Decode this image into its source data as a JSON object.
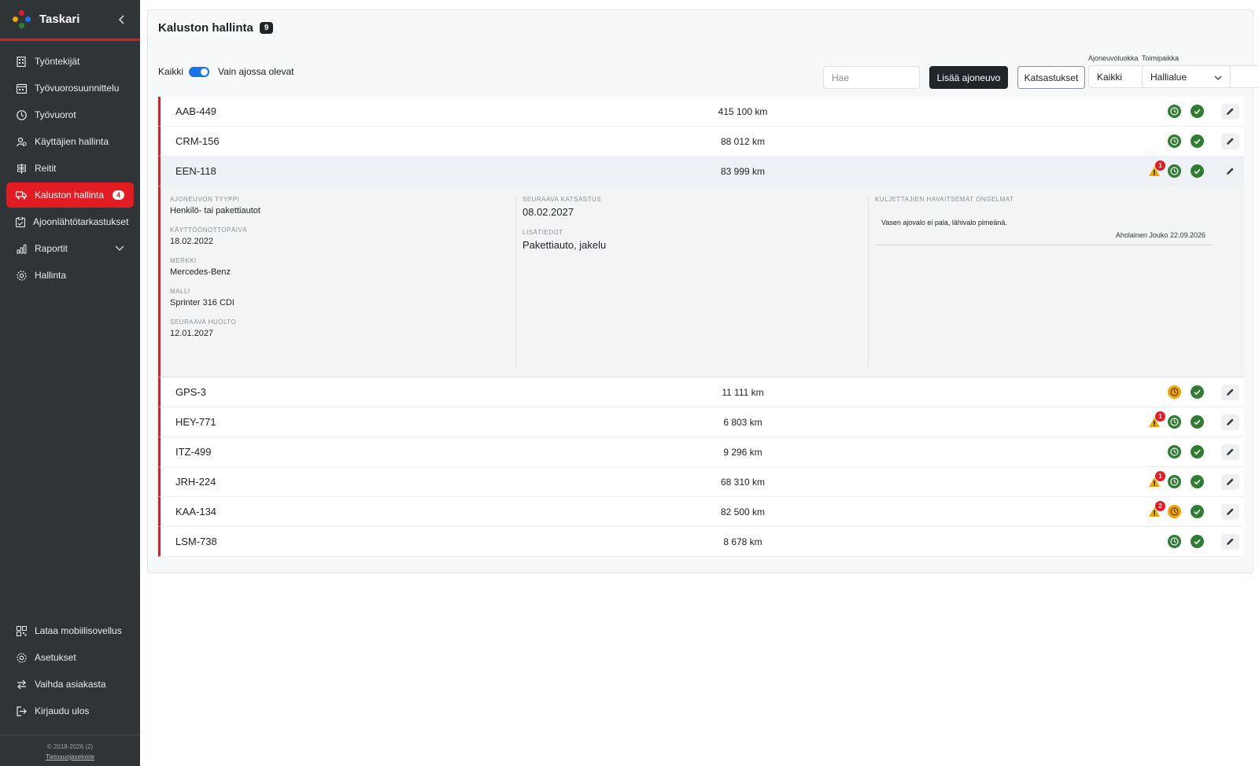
{
  "app": {
    "name": "Taskari"
  },
  "sidebar": {
    "items": [
      {
        "label": "Työntekijät",
        "icon": "building-icon"
      },
      {
        "label": "Työvuorosuunnittelu",
        "icon": "calendar-icon"
      },
      {
        "label": "Työvuorot",
        "icon": "clock-icon"
      },
      {
        "label": "Käyttäjien hallinta",
        "icon": "users-icon"
      },
      {
        "label": "Reitit",
        "icon": "signpost-icon"
      },
      {
        "label": "Kaluston hallinta",
        "icon": "truck-icon",
        "badge": "4",
        "active": true
      },
      {
        "label": "Ajoonlähtötarkastukset",
        "icon": "clipboard-icon"
      },
      {
        "label": "Raportit",
        "icon": "chart-icon"
      },
      {
        "label": "Hallinta",
        "icon": "gear-icon"
      }
    ],
    "bottom_items": [
      {
        "label": "Lataa mobiilisovellus",
        "icon": "qr-icon"
      },
      {
        "label": "Asetukset",
        "icon": "gear-icon"
      },
      {
        "label": "Vaihda asiakasta",
        "icon": "swap-icon"
      },
      {
        "label": "Kirjaudu ulos",
        "icon": "logout-icon"
      }
    ],
    "footer": {
      "copyright": "© 2018-2026 (2)",
      "privacy": "Tietosuojaseloste"
    }
  },
  "page": {
    "title": "Kaluston hallinta",
    "count": "9",
    "toggle_left": "Kaikki",
    "toggle_right": "Vain ajossa olevat",
    "search_placeholder": "Hae",
    "add_button": "Lisää ajoneuvo",
    "inspections_button": "Katsastukset",
    "vehicle_class": {
      "label": "Ajoneuvoluokka",
      "value": "Kaikki"
    },
    "location": {
      "label": "Toimipaikka",
      "value": "Hallialue"
    }
  },
  "vehicles": [
    {
      "plate": "AAB-449",
      "km": "415 100 km",
      "warnings": "",
      "clock": "green"
    },
    {
      "plate": "CRM-156",
      "km": "88 012 km",
      "warnings": "",
      "clock": "green"
    },
    {
      "plate": "EEN-118",
      "km": "83 999 km",
      "warnings": "1",
      "clock": "green"
    },
    {
      "plate": "GPS-3",
      "km": "11 111 km",
      "warnings": "",
      "clock": "orange"
    },
    {
      "plate": "HEY-771",
      "km": "6 803 km",
      "warnings": "1",
      "clock": "green"
    },
    {
      "plate": "ITZ-499",
      "km": "9 296 km",
      "warnings": "",
      "clock": "green"
    },
    {
      "plate": "JRH-224",
      "km": "68 310 km",
      "warnings": "1",
      "clock": "green"
    },
    {
      "plate": "KAA-134",
      "km": "82 500 km",
      "warnings": "2",
      "clock": "orange"
    },
    {
      "plate": "LSM-738",
      "km": "8 678 km",
      "warnings": "",
      "clock": "green"
    }
  ],
  "details": {
    "type_label": "AJONEUVON TYYPPI",
    "type_value": "Henkilö- tai pakettiautot",
    "start_label": "KÄYTTÖÖNOTTOPÄIVÄ",
    "start_value": "18.02.2022",
    "brand_label": "MERKKI",
    "brand_value": "Mercedes-Benz",
    "model_label": "MALLI",
    "model_value": "Sprinter 316 CDI",
    "service_label": "SEURAAVA HUOLTO",
    "service_value": "12.01.2027",
    "inspection_label": "SEURAAVA KATSASTUS",
    "inspection_value": "08.02.2027",
    "extra_label": "LISÄTIEDOT",
    "extra_value": "Pakettiauto, jakelu",
    "issues_label": "KULJETTAJIEN HAVAITSEMAT ONGELMAT",
    "issue_text": "Vasen ajovalo ei pala, lähivalo pimeänä.",
    "issue_meta": "Aholainen Jouko 22.09.2026"
  },
  "colors": {
    "accent": "#e31b23",
    "sidebar": "#2f3437",
    "ok": "#2e7d32",
    "warn": "#f0a500"
  }
}
